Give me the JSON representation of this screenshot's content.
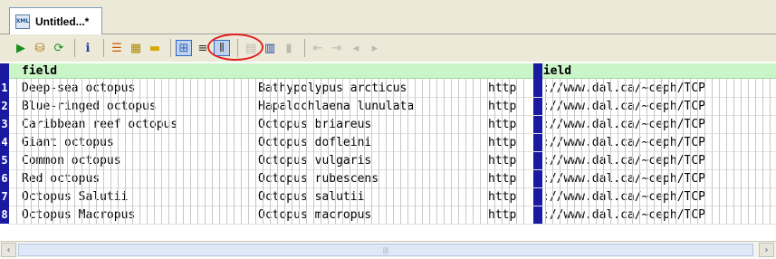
{
  "tab": {
    "title": "Untitled...*",
    "icon": "xml-file-icon",
    "icon_text": "XML"
  },
  "toolbar": {
    "buttons": [
      {
        "name": "run-icon",
        "glyph": "▶",
        "color": "#1a8f1a",
        "pressed": false,
        "disabled": false
      },
      {
        "name": "open-icon",
        "glyph": "⛁",
        "color": "#b07a14",
        "pressed": false,
        "disabled": false
      },
      {
        "name": "refresh-icon",
        "glyph": "⟳",
        "color": "#1a8f1a",
        "pressed": false,
        "disabled": false
      },
      {
        "sep": true
      },
      {
        "name": "info-icon",
        "glyph": "ℹ",
        "color": "#1a3fa8",
        "pressed": false,
        "disabled": false
      },
      {
        "sep": true
      },
      {
        "name": "list-icon",
        "glyph": "☰",
        "color": "#c85a00",
        "pressed": false,
        "disabled": false
      },
      {
        "name": "grid-format-icon",
        "glyph": "▦",
        "color": "#b08a00",
        "pressed": false,
        "disabled": false
      },
      {
        "name": "ruler-icon",
        "glyph": "▬",
        "color": "#d6a800",
        "pressed": false,
        "disabled": false
      },
      {
        "sep": true
      },
      {
        "name": "table-view-icon",
        "glyph": "⊞",
        "color": "#2f5fb0",
        "pressed": true,
        "disabled": false
      },
      {
        "name": "row-lines-icon",
        "glyph": "≡",
        "color": "#333",
        "pressed": false,
        "disabled": false
      },
      {
        "name": "column-lines-icon",
        "glyph": "⦀",
        "color": "#333",
        "pressed": true,
        "disabled": false
      },
      {
        "sep": true
      },
      {
        "name": "align-left-icon",
        "glyph": "▤",
        "color": "#666",
        "pressed": false,
        "disabled": true
      },
      {
        "name": "table-icon",
        "glyph": "▥",
        "color": "#1a3fa8",
        "pressed": false,
        "disabled": false
      },
      {
        "name": "chart-icon",
        "glyph": "▮",
        "color": "#666",
        "pressed": false,
        "disabled": true
      },
      {
        "sep": true
      },
      {
        "name": "indent-icon",
        "glyph": "⇤",
        "color": "#666",
        "pressed": false,
        "disabled": true
      },
      {
        "name": "outdent-icon",
        "glyph": "⇥",
        "color": "#666",
        "pressed": false,
        "disabled": true
      },
      {
        "name": "move-left-icon",
        "glyph": "◂",
        "color": "#666",
        "pressed": false,
        "disabled": true
      },
      {
        "name": "move-right-icon",
        "glyph": "▸",
        "color": "#666",
        "pressed": false,
        "disabled": true
      }
    ]
  },
  "grid": {
    "headers": [
      "field",
      "field"
    ],
    "rows": [
      {
        "n": "1",
        "common": "Deep-sea octopus",
        "latin": "Bathypolypus arcticus",
        "url_a": "http",
        "url_b": "://www.dal.ca/~ceph/TCP"
      },
      {
        "n": "2",
        "common": "Blue-ringed octopus",
        "latin": "Hapalochlaena lunulata",
        "url_a": "http",
        "url_b": "://www.dal.ca/~ceph/TCP"
      },
      {
        "n": "3",
        "common": "Caribbean reef octopus",
        "latin": "Octopus briareus",
        "url_a": "http",
        "url_b": "://www.dal.ca/~ceph/TCP"
      },
      {
        "n": "4",
        "common": "Giant octopus",
        "latin": "Octopus dofleini",
        "url_a": "http",
        "url_b": "://www.dal.ca/~ceph/TCP"
      },
      {
        "n": "5",
        "common": "Common octopus",
        "latin": "Octopus vulgaris",
        "url_a": "http",
        "url_b": "://www.dal.ca/~ceph/TCP"
      },
      {
        "n": "6",
        "common": "Red octopus",
        "latin": "Octopus rubescens",
        "url_a": "http",
        "url_b": "://www.dal.ca/~ceph/TCP"
      },
      {
        "n": "7",
        "common": "Octopus Salutii",
        "latin": "Octopus salutii",
        "url_a": "http",
        "url_b": "://www.dal.ca/~ceph/TCP"
      },
      {
        "n": "8",
        "common": "Octopus Macropus",
        "latin": "Octopus macropus",
        "url_a": "http",
        "url_b": "://www.dal.ca/~ceph/TCP"
      }
    ]
  },
  "scrollbar": {
    "left_arrow": "‹",
    "right_arrow": "›",
    "thumb_grip": "|||"
  },
  "colors": {
    "header_bg": "#c9f5c9",
    "row_number_bg": "#1a1aa0",
    "highlight": "#e21f1f"
  }
}
